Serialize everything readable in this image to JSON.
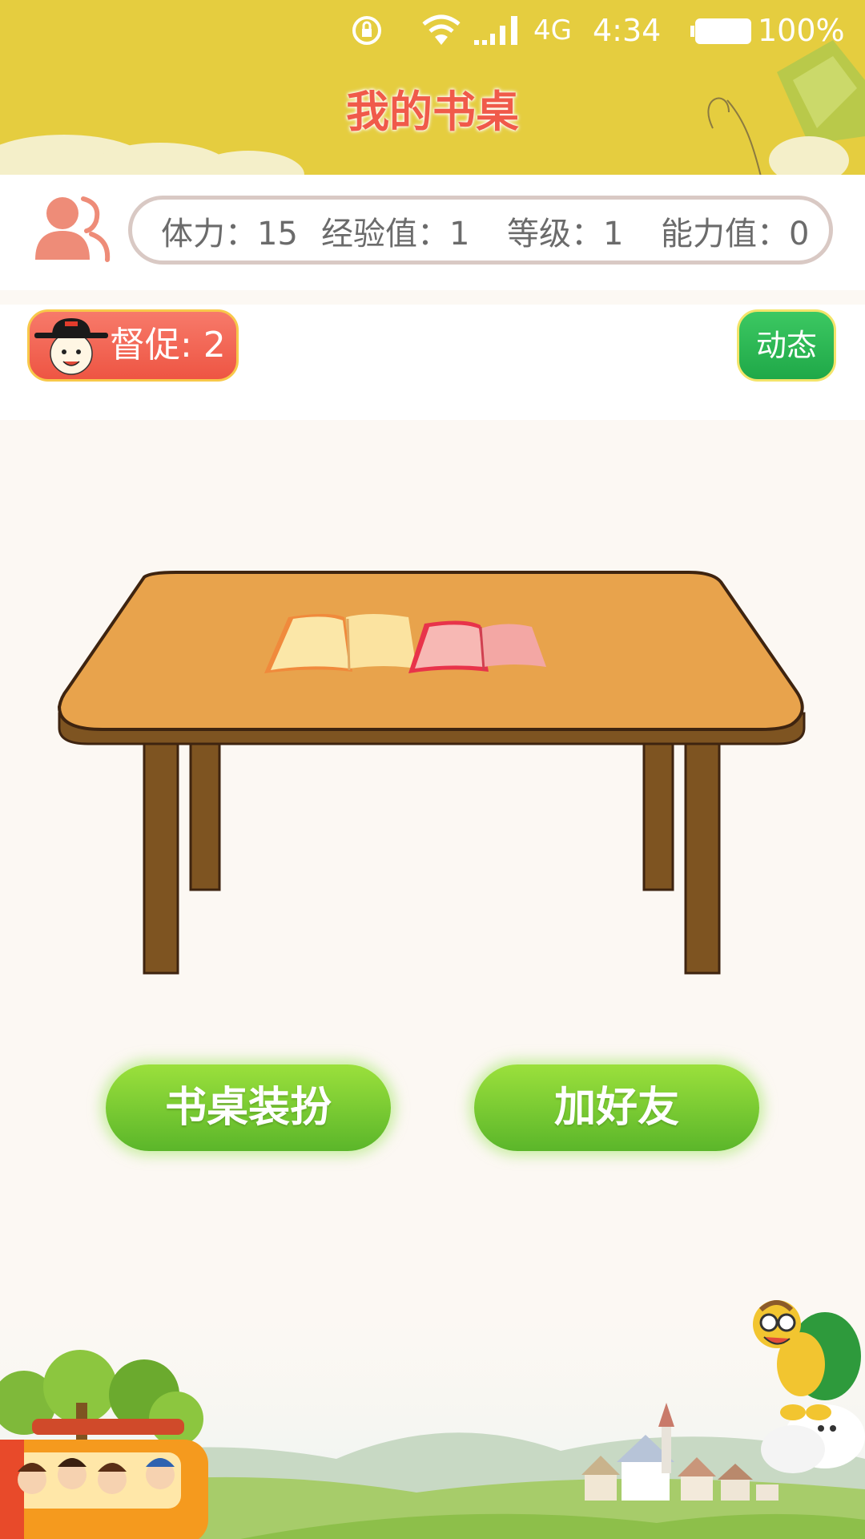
{
  "status_bar": {
    "network": "4G",
    "time": "4:34",
    "battery": "100%"
  },
  "header": {
    "title": "我的书桌"
  },
  "stats": {
    "stamina": "体力：15",
    "experience": "经验值：1",
    "level": "等级：1",
    "ability": "能力值：0"
  },
  "actions": {
    "supervise": "督促: 2",
    "dynamics": "动态"
  },
  "buttons": {
    "desk_dress": "书桌装扮",
    "add_friend": "加好友"
  },
  "icons": {
    "rotation_lock": "rotation-lock-icon",
    "wifi": "wifi-icon",
    "signal": "signal-icon",
    "battery": "battery-icon",
    "friends": "friends-icon",
    "supervisor_avatar": "official-face-icon"
  },
  "colors": {
    "header_bg": "#E5CD3F",
    "title": "#F05A4A",
    "supervise_bg": "#EE5543",
    "dynamics_bg": "#1FA848",
    "button_green": "#6DC42E",
    "desk_top": "#E8A34C",
    "desk_leg": "#7E5421"
  }
}
